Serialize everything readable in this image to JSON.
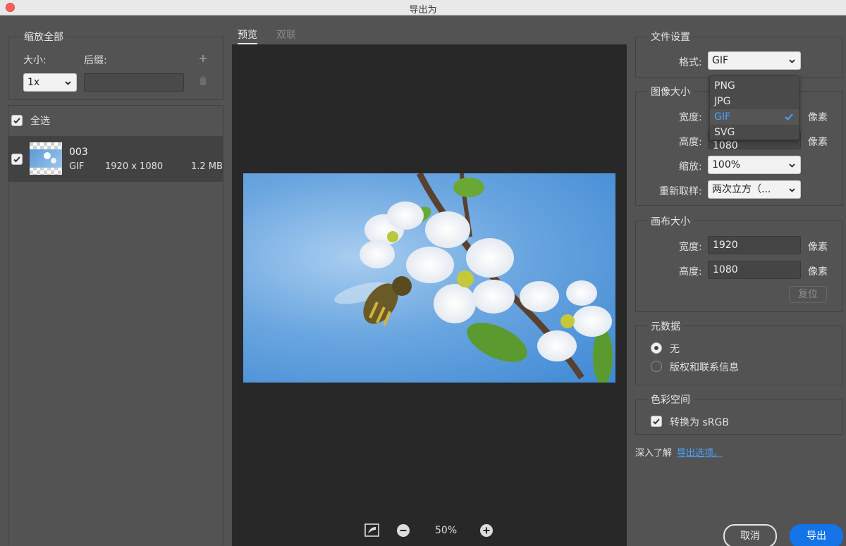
{
  "window": {
    "title": "导出为"
  },
  "left": {
    "scale_all_title": "缩放全部",
    "size_label": "大小:",
    "suffix_label": "后缀:",
    "size_value": "1x",
    "suffix_value": "",
    "select_all_label": "全选",
    "asset": {
      "name": "003",
      "format": "GIF",
      "dimensions": "1920 x 1080",
      "filesize": "1.2 MB"
    }
  },
  "preview": {
    "tabs": [
      {
        "label": "预览",
        "active": true
      },
      {
        "label": "双联",
        "active": false
      }
    ],
    "zoom": "50%"
  },
  "file_settings": {
    "title": "文件设置",
    "format_label": "格式:",
    "format_value": "GIF",
    "format_options": [
      "PNG",
      "JPG",
      "GIF",
      "SVG"
    ],
    "selected_option": "GIF"
  },
  "image_size": {
    "title": "图像大小",
    "width_label": "宽度:",
    "height_label": "高度:",
    "height_value_partial": "1080",
    "unit": "像素",
    "scale_label": "缩放:",
    "scale_value": "100%",
    "resample_label": "重新取样:",
    "resample_value": "两次立方（..."
  },
  "canvas_size": {
    "title": "画布大小",
    "width_label": "宽度:",
    "width_value": "1920",
    "height_label": "高度:",
    "height_value": "1080",
    "unit": "像素",
    "reset_label": "复位"
  },
  "metadata": {
    "title": "元数据",
    "options": [
      "无",
      "版权和联系信息"
    ],
    "selected": "无"
  },
  "color_space": {
    "title": "色彩空间",
    "convert_label": "转换为 sRGB"
  },
  "learn_more": {
    "prefix": "深入了解",
    "link": "导出选项。"
  },
  "footer": {
    "cancel": "取消",
    "export": "导出"
  },
  "colors": {
    "accent": "#1473e6",
    "link": "#4aa3ff",
    "panel_bg": "#535353",
    "preview_bg": "#282828"
  }
}
